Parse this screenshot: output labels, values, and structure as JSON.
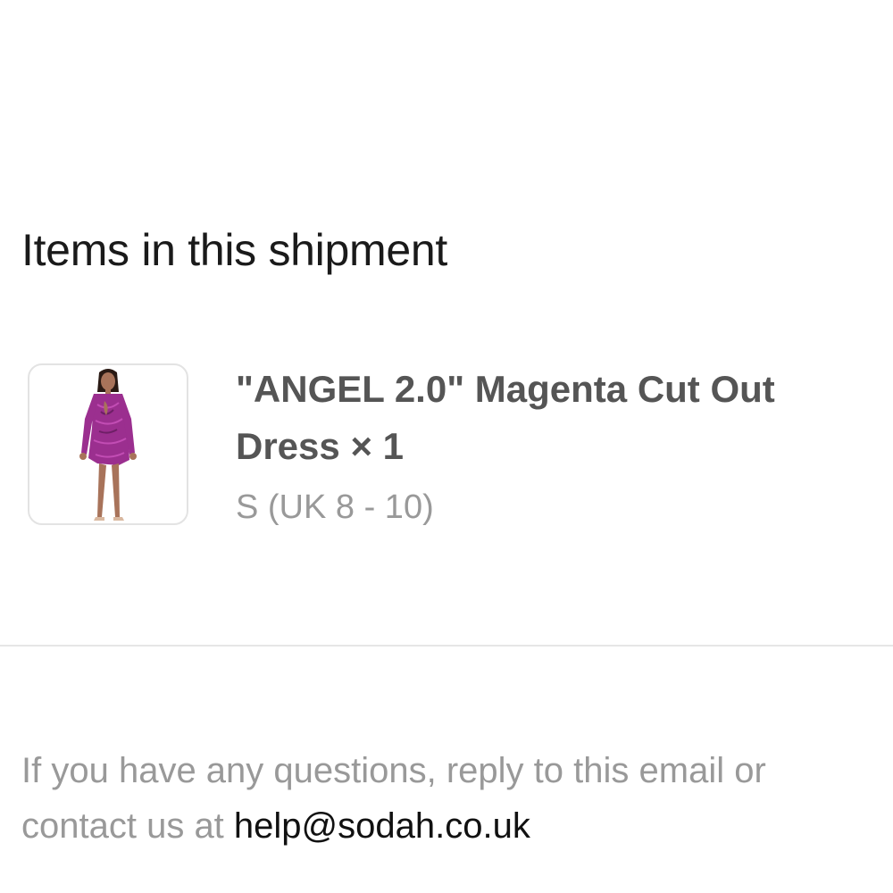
{
  "shipment": {
    "title": "Items in this shipment",
    "items": [
      {
        "name": "\"ANGEL 2.0\" Magenta Cut Out Dress",
        "quantity": "× 1",
        "variant": "S (UK 8 - 10)",
        "thumbnail_icon": "product-dress-photo",
        "dress_color": "#9b2f8f"
      }
    ]
  },
  "footer": {
    "text": "If you have any questions, reply to this email or contact us at",
    "email": "help@sodah.co.uk"
  },
  "colors": {
    "background": "#ffffff",
    "title": "#1a1a1a",
    "item_name": "#555555",
    "muted": "#999999",
    "divider": "#e6e6e6",
    "email": "#111111"
  }
}
